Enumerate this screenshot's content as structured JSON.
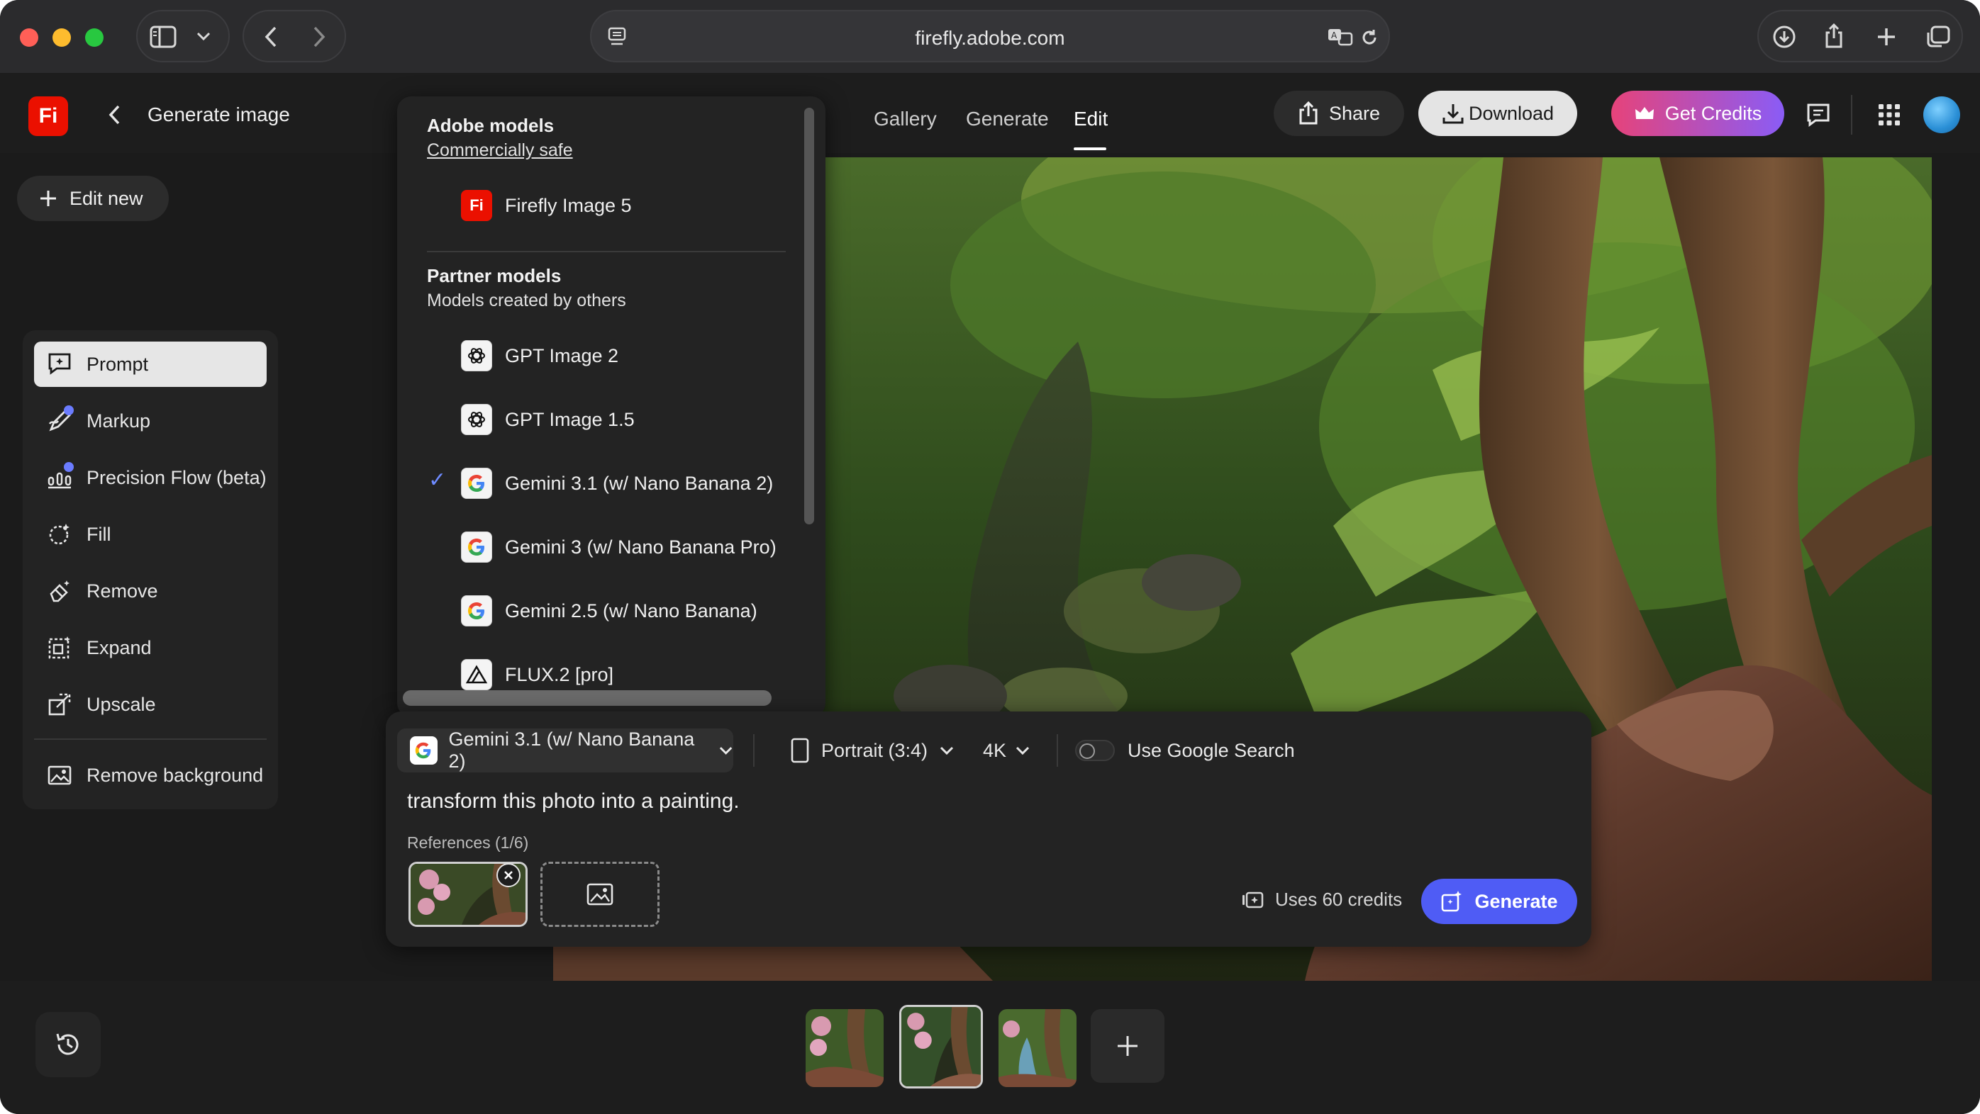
{
  "browser": {
    "url": "firefly.adobe.com"
  },
  "header": {
    "back_label": "Generate image",
    "logo_text": "Fi",
    "tabs": [
      "Gallery",
      "Generate",
      "Edit"
    ],
    "active_tab": "Edit",
    "share_label": "Share",
    "download_label": "Download",
    "credits_label": "Get Credits"
  },
  "sidebar": {
    "edit_new_label": "Edit new",
    "tools": [
      {
        "label": "Prompt",
        "icon": "prompt-icon",
        "active": true
      },
      {
        "label": "Markup",
        "icon": "markup-icon",
        "badge": true
      },
      {
        "label": "Precision Flow (beta)",
        "icon": "precision-flow-icon",
        "badge": true
      },
      {
        "label": "Fill",
        "icon": "fill-icon"
      },
      {
        "label": "Remove",
        "icon": "remove-icon"
      },
      {
        "label": "Expand",
        "icon": "expand-icon"
      },
      {
        "label": "Upscale",
        "icon": "upscale-icon"
      },
      {
        "label": "Remove background",
        "icon": "remove-background-icon"
      }
    ]
  },
  "model_dropdown": {
    "adobe_heading": "Adobe models",
    "adobe_sub": "Commercially safe",
    "adobe_models": [
      {
        "label": "Firefly Image 5",
        "icon": "firefly-icon"
      }
    ],
    "partner_heading": "Partner models",
    "partner_sub": "Models created by others",
    "partner_models": [
      {
        "label": "GPT Image 2",
        "icon": "openai-icon"
      },
      {
        "label": "GPT Image 1.5",
        "icon": "openai-icon"
      },
      {
        "label": "Gemini 3.1 (w/ Nano Banana 2)",
        "icon": "google-icon",
        "selected": true
      },
      {
        "label": "Gemini 3 (w/ Nano Banana Pro)",
        "icon": "google-icon"
      },
      {
        "label": "Gemini 2.5 (w/ Nano Banana)",
        "icon": "google-icon"
      },
      {
        "label": "FLUX.2 [pro]",
        "icon": "flux-icon"
      }
    ],
    "check_glyph": "✓"
  },
  "prompt_panel": {
    "selected_model": "Gemini 3.1 (w/ Nano Banana 2)",
    "aspect_ratio": "Portrait (3:4)",
    "resolution": "4K",
    "google_search_label": "Use Google Search",
    "google_search_on": false,
    "prompt_text": "transform this photo into a painting.",
    "references_label": "References (1/6)",
    "credits_text": "Uses 60 credits",
    "generate_label": "Generate"
  },
  "colors": {
    "accent": "#4f5cf5",
    "credits_gradient_start": "#e6437a",
    "credits_gradient_end": "#8a5cf6",
    "firefly_red": "#eb1000",
    "check_blue": "#6e8bff"
  }
}
